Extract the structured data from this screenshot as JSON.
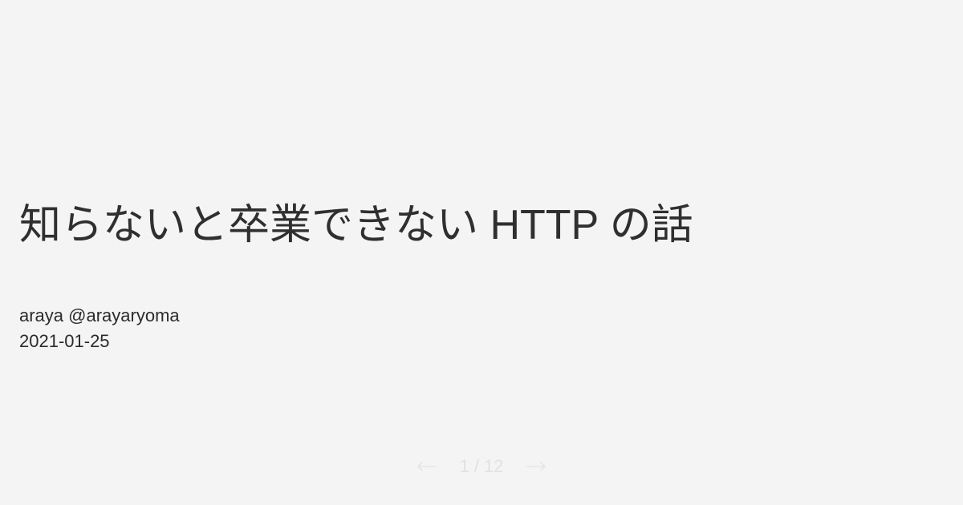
{
  "slide": {
    "title": "知らないと卒業できない HTTP の話",
    "author": "araya @arayaryoma",
    "date": "2021-01-25"
  },
  "pager": {
    "previous_icon": "left-arrow-icon",
    "next_icon": "right-arrow-icon",
    "current_page": "1",
    "separator": "/",
    "total_pages": "12"
  }
}
